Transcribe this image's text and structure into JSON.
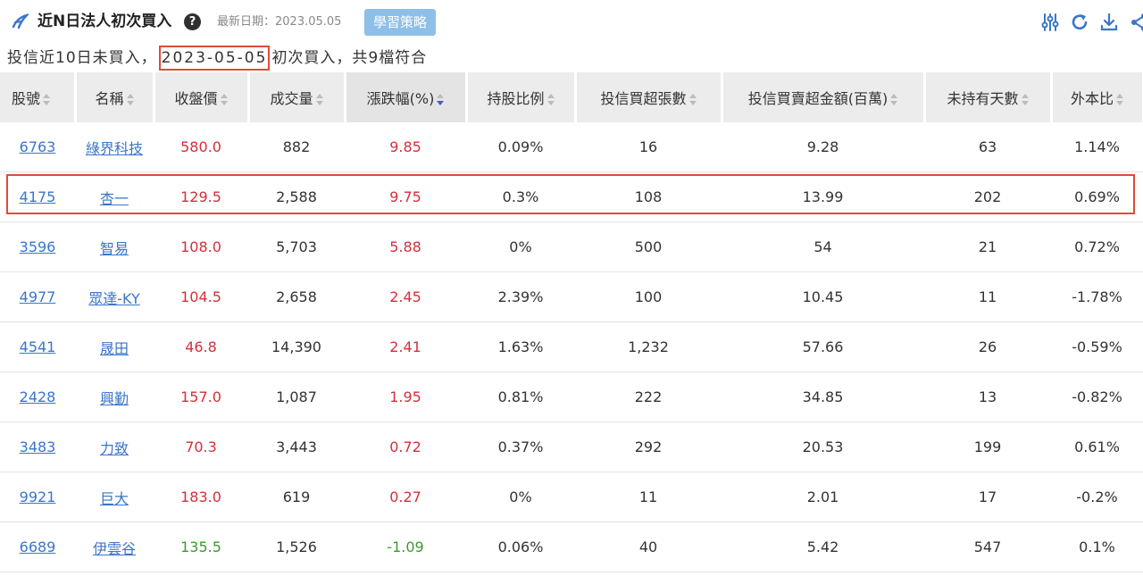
{
  "header": {
    "title": "近N日法人初次買入",
    "help_glyph": "?",
    "date_label": "最新日期：2023.05.05",
    "learn_button": "學習策略"
  },
  "subtitle": {
    "prefix": "投信近10日未買入，",
    "date": "2023-05-05",
    "suffix": "初次買入，共9檔符合"
  },
  "columns": [
    "股號",
    "名稱",
    "收盤價",
    "成交量",
    "漲跌幅(%)",
    "持股比例",
    "投信買超張數",
    "投信買賣超金額(百萬)",
    "未持有天數",
    "外本比"
  ],
  "rows": [
    {
      "code": "6763",
      "name": "綠界科技",
      "close": "580.0",
      "volume": "882",
      "change": "9.85",
      "dir": "up",
      "holding": "0.09%",
      "net_buy": "16",
      "amount": "9.28",
      "days": "63",
      "ratio": "1.14%"
    },
    {
      "code": "4175",
      "name": "杏一",
      "close": "129.5",
      "volume": "2,588",
      "change": "9.75",
      "dir": "up",
      "holding": "0.3%",
      "net_buy": "108",
      "amount": "13.99",
      "days": "202",
      "ratio": "0.69%"
    },
    {
      "code": "3596",
      "name": "智易",
      "close": "108.0",
      "volume": "5,703",
      "change": "5.88",
      "dir": "up",
      "holding": "0%",
      "net_buy": "500",
      "amount": "54",
      "days": "21",
      "ratio": "0.72%"
    },
    {
      "code": "4977",
      "name": "眾達-KY",
      "close": "104.5",
      "volume": "2,658",
      "change": "2.45",
      "dir": "up",
      "holding": "2.39%",
      "net_buy": "100",
      "amount": "10.45",
      "days": "11",
      "ratio": "-1.78%"
    },
    {
      "code": "4541",
      "name": "晟田",
      "close": "46.8",
      "volume": "14,390",
      "change": "2.41",
      "dir": "up",
      "holding": "1.63%",
      "net_buy": "1,232",
      "amount": "57.66",
      "days": "26",
      "ratio": "-0.59%"
    },
    {
      "code": "2428",
      "name": "興勤",
      "close": "157.0",
      "volume": "1,087",
      "change": "1.95",
      "dir": "up",
      "holding": "0.81%",
      "net_buy": "222",
      "amount": "34.85",
      "days": "13",
      "ratio": "-0.82%"
    },
    {
      "code": "3483",
      "name": "力致",
      "close": "70.3",
      "volume": "3,443",
      "change": "0.72",
      "dir": "up",
      "holding": "0.37%",
      "net_buy": "292",
      "amount": "20.53",
      "days": "199",
      "ratio": "0.61%"
    },
    {
      "code": "9921",
      "name": "巨大",
      "close": "183.0",
      "volume": "619",
      "change": "0.27",
      "dir": "up",
      "holding": "0%",
      "net_buy": "11",
      "amount": "2.01",
      "days": "17",
      "ratio": "-0.2%"
    },
    {
      "code": "6689",
      "name": "伊雲谷",
      "close": "135.5",
      "volume": "1,526",
      "change": "-1.09",
      "dir": "down",
      "holding": "0.06%",
      "net_buy": "40",
      "amount": "5.42",
      "days": "547",
      "ratio": "0.1%"
    }
  ],
  "colors": {
    "up": "#d3303b",
    "down": "#3d9a2e",
    "link": "#3a76c9",
    "highlight": "#e04a3a",
    "button": "#8dbfe8"
  },
  "icons": [
    "logo-icon",
    "help-icon",
    "filter-sliders-icon",
    "refresh-icon",
    "download-icon",
    "share-icon"
  ]
}
